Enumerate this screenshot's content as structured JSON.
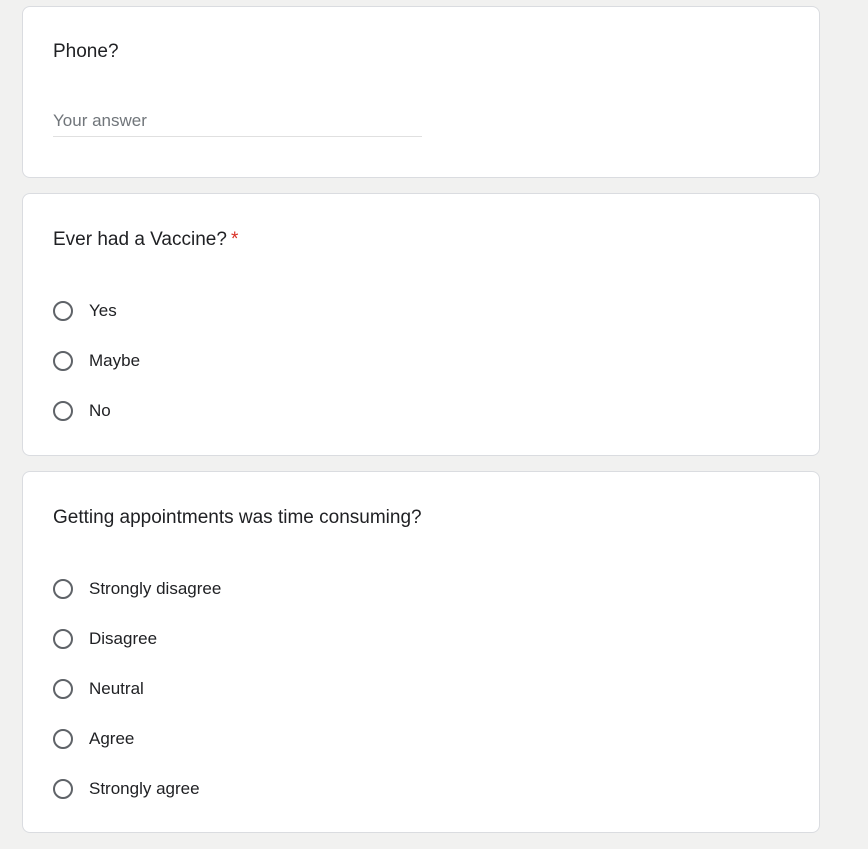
{
  "questions": {
    "phone": {
      "title": "Phone?",
      "placeholder": "Your answer",
      "value": ""
    },
    "vaccine": {
      "title": "Ever had a Vaccine?",
      "required_marker": "*",
      "options": [
        "Yes",
        "Maybe",
        "No"
      ]
    },
    "appointments": {
      "title": "Getting appointments was time consuming?",
      "options": [
        "Strongly disagree",
        "Disagree",
        "Neutral",
        "Agree",
        "Strongly agree"
      ]
    }
  },
  "colors": {
    "page_background": "#f1f1f0",
    "card_background": "#ffffff",
    "card_border": "#dadce0",
    "required_star": "#d93025",
    "radio_border": "#5f6368",
    "text": "#202124",
    "placeholder": "#70757a"
  }
}
